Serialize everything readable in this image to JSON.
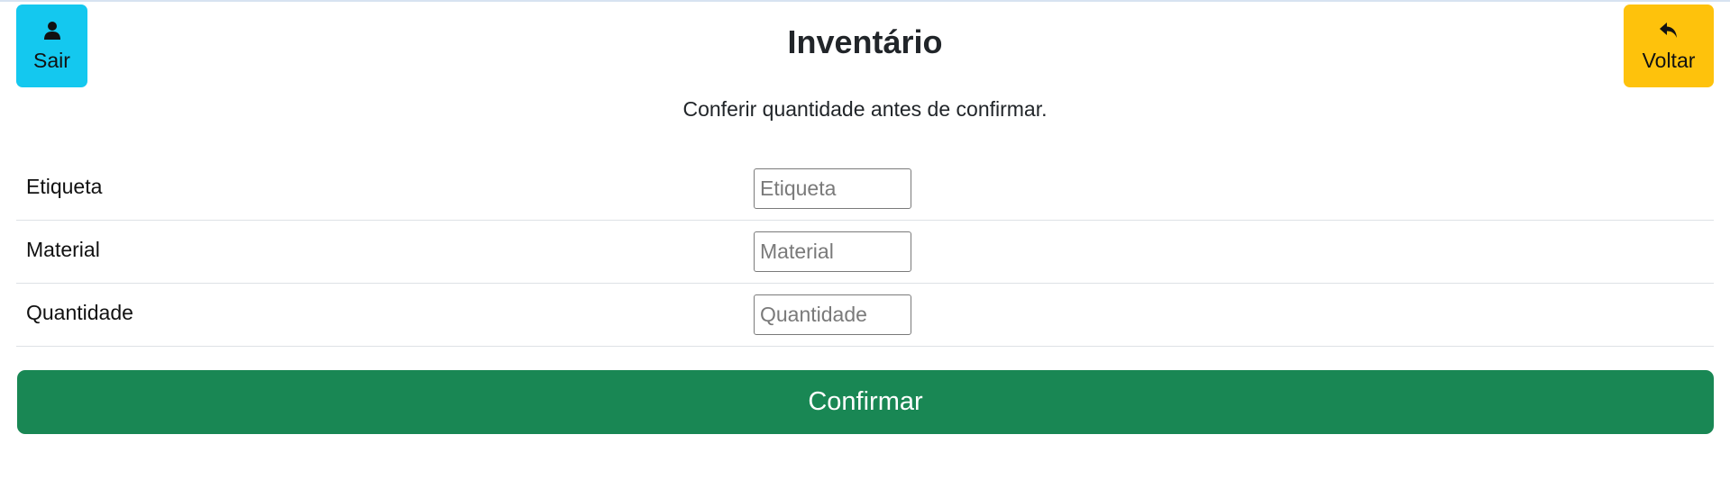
{
  "header": {
    "title": "Inventário",
    "subtitle": "Conferir quantidade antes de confirmar.",
    "left_button": {
      "label": "Sair",
      "icon": "user-icon",
      "color": "#14c8ef"
    },
    "right_button": {
      "label": "Voltar",
      "icon": "reply-arrow-icon",
      "color": "#fec20c"
    }
  },
  "form": {
    "rows": [
      {
        "label": "Etiqueta",
        "placeholder": "Etiqueta",
        "value": ""
      },
      {
        "label": "Material",
        "placeholder": "Material",
        "value": ""
      },
      {
        "label": "Quantidade",
        "placeholder": "Quantidade",
        "value": ""
      }
    ]
  },
  "actions": {
    "confirm_label": "Confirmar",
    "confirm_color": "#198754"
  }
}
